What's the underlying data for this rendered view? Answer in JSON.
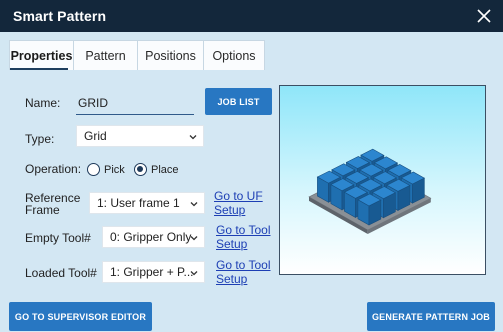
{
  "window": {
    "title": "Smart Pattern"
  },
  "tabs": [
    {
      "label": "Properties",
      "active": true
    },
    {
      "label": "Pattern"
    },
    {
      "label": "Positions"
    },
    {
      "label": "Options"
    }
  ],
  "form": {
    "name_label": "Name:",
    "name_value": "GRID",
    "type_label": "Type:",
    "type_value": "Grid",
    "operation_label": "Operation:",
    "operation_options": [
      "Pick",
      "Place"
    ],
    "operation_selected": "Place",
    "ref_frame_label_1": "Reference",
    "ref_frame_label_2": "Frame",
    "ref_frame_value": "1: User frame 1",
    "empty_tool_label": "Empty Tool#",
    "empty_tool_value": "0: Gripper Only",
    "loaded_tool_label": "Loaded Tool#",
    "loaded_tool_value": "1: Gripper + P..."
  },
  "links": {
    "uf_setup_1": "Go to UF",
    "uf_setup_2": "Setup",
    "tool_setup_1": "Go to Tool",
    "tool_setup_2": "Setup",
    "tool_setup2_1": "Go to Tool",
    "tool_setup2_2": "Setup"
  },
  "buttons": {
    "job_list": "JOB LIST",
    "supervisor": "GO TO SUPERVISOR EDITOR",
    "generate": "GENERATE PATTERN JOB"
  },
  "icons": {
    "close": "close-icon",
    "chevron": "chevron-down-icon",
    "preview": "pattern-grid-3d-preview"
  },
  "colors": {
    "titlebar": "#13273b",
    "background": "#d3e7f3",
    "button": "#2877c2",
    "link": "#1d3fb4",
    "box": "#1f6fb0"
  }
}
